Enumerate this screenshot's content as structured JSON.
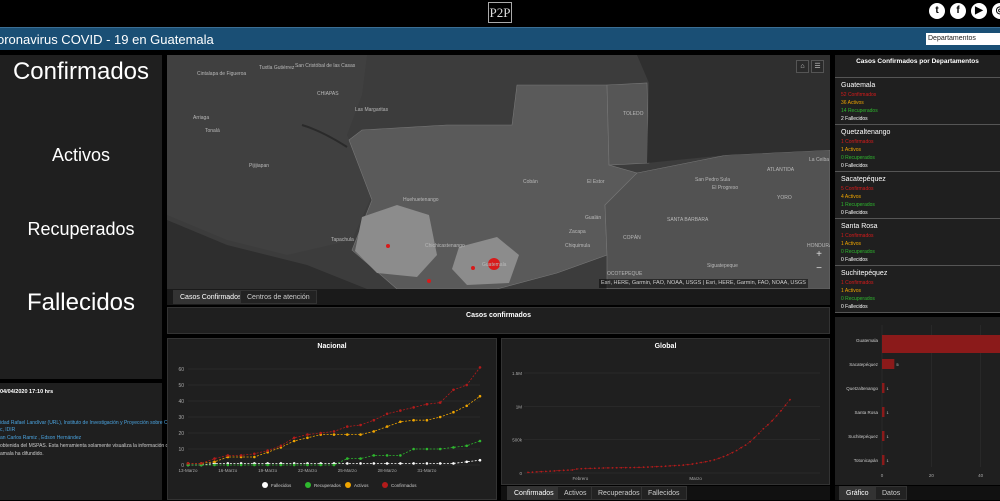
{
  "header": {
    "logo_text": "P2P",
    "title": "oronavirus COVID - 19 en Guatemala",
    "dept_select": "Departamentos"
  },
  "social": [
    {
      "icon": "twitter-icon",
      "glyph": "t"
    },
    {
      "icon": "facebook-icon",
      "glyph": "f"
    },
    {
      "icon": "youtube-icon",
      "glyph": "▶"
    },
    {
      "icon": "instagram-icon",
      "glyph": "◎"
    }
  ],
  "stats": {
    "confirmados": "Confirmados",
    "activos": "Activos",
    "recuperados": "Recuperados",
    "fallecidos": "Fallecidos"
  },
  "map": {
    "labels": [
      {
        "t": "Tuxtla Gutiérrez",
        "x": 92,
        "y": 10
      },
      {
        "t": "San Cristóbal de las Casas",
        "x": 128,
        "y": 8
      },
      {
        "t": "Cintalapa de Figueroa",
        "x": 30,
        "y": 16
      },
      {
        "t": "CHIAPAS",
        "x": 150,
        "y": 36
      },
      {
        "t": "Las Margaritas",
        "x": 188,
        "y": 52
      },
      {
        "t": "Arriaga",
        "x": 26,
        "y": 60
      },
      {
        "t": "Tonalá",
        "x": 38,
        "y": 73
      },
      {
        "t": "Pijijiapan",
        "x": 82,
        "y": 108
      },
      {
        "t": "Huehuetenango",
        "x": 236,
        "y": 142
      },
      {
        "t": "Cobán",
        "x": 356,
        "y": 124
      },
      {
        "t": "El Estor",
        "x": 420,
        "y": 124
      },
      {
        "t": "Chiquimula",
        "x": 398,
        "y": 188
      },
      {
        "t": "Gualán",
        "x": 418,
        "y": 160
      },
      {
        "t": "Zacapa",
        "x": 402,
        "y": 174
      },
      {
        "t": "Tapachula",
        "x": 164,
        "y": 182
      },
      {
        "t": "Chichicastenango",
        "x": 258,
        "y": 188
      },
      {
        "t": "Guatemala",
        "x": 315,
        "y": 207
      },
      {
        "t": "San Pedro Sula",
        "x": 528,
        "y": 122
      },
      {
        "t": "El Progreso",
        "x": 545,
        "y": 130
      },
      {
        "t": "La Ceiba",
        "x": 642,
        "y": 102
      },
      {
        "t": "ATLANTIDA",
        "x": 600,
        "y": 112
      },
      {
        "t": "YORO",
        "x": 610,
        "y": 140
      },
      {
        "t": "COPÁN",
        "x": 456,
        "y": 180
      },
      {
        "t": "SANTA BARBARA",
        "x": 500,
        "y": 162
      },
      {
        "t": "Siguatepeque",
        "x": 540,
        "y": 208
      },
      {
        "t": "OCOTEPEQUE",
        "x": 440,
        "y": 216
      },
      {
        "t": "TOLEDO",
        "x": 456,
        "y": 56
      },
      {
        "t": "HONDURAS",
        "x": 640,
        "y": 188
      }
    ],
    "attribution": "Esri, HERE, Garmin, FAO, NOAA, USGS | Esri, HERE, Garmin, FAO, NOAA, USGS",
    "zoom_in": "+",
    "zoom_out": "−",
    "tabs": [
      "Casos Confirmados",
      "Centros de atención"
    ]
  },
  "casos_header": "Casos confirmados",
  "departments_title": "Casos Confirmados por Departamentos",
  "departments": [
    {
      "name": "Guatemala",
      "confirmados": "52 Confirmados",
      "activos": "36 Activos",
      "recuperados": "14 Recuperados",
      "fallecidos": "2 Fallecidos"
    },
    {
      "name": "Quetzaltenango",
      "confirmados": "1 Confirmados",
      "activos": "1 Activos",
      "recuperados": "0 Recuperados",
      "fallecidos": "0 Fallecidos"
    },
    {
      "name": "Sacatepéquez",
      "confirmados": "5 Confirmados",
      "activos": "4 Activos",
      "recuperados": "1 Recuperados",
      "fallecidos": "0 Fallecidos"
    },
    {
      "name": "Santa Rosa",
      "confirmados": "1 Confirmados",
      "activos": "1 Activos",
      "recuperados": "0 Recuperados",
      "fallecidos": "0 Fallecidos"
    },
    {
      "name": "Suchitepéquez",
      "confirmados": "1 Confirmados",
      "activos": "1 Activos",
      "recuperados": "0 Recuperados",
      "fallecidos": "0 Fallecidos"
    },
    {
      "name": "Totonicapán",
      "confirmados": "",
      "activos": "",
      "recuperados": "",
      "fallecidos": ""
    }
  ],
  "info": {
    "updated": "04/04/2020 17:10 hrs",
    "line1": "idad Rafael Landívar (URL), Instituto de Investigación y Proyección sobre Ciencia",
    "line2": "c, IDIR",
    "line3": "an Carlos Ramiz , Edson Hernández",
    "line4": "obtenida del MSPAS. Esta herramienta solamente visualiza la información que el",
    "line5": "amala ha difundido."
  },
  "bottom_tabs": [
    "Confirmados",
    "Activos",
    "Recuperados",
    "Fallecidos"
  ],
  "right_tabs": [
    "Gráfico",
    "Datos"
  ],
  "colors": {
    "fallecidos": "#ffffff",
    "recuperados": "#2eb82e",
    "activos": "#f0a500",
    "confirmados": "#b31b1b"
  },
  "chart_data": [
    {
      "type": "line",
      "title": "Nacional",
      "categories": [
        "13-Marzo",
        "14-Marzo",
        "15-Marzo",
        "16-Marzo",
        "17-Marzo",
        "18-Marzo",
        "19-Marzo",
        "20-Marzo",
        "21-Marzo",
        "22-Marzo",
        "23-Marzo",
        "24-Marzo",
        "25-Marzo",
        "26-Marzo",
        "27-Marzo",
        "28-Marzo",
        "29-Marzo",
        "30-Marzo",
        "31-Marzo",
        "01-Abril",
        "02-Abril",
        "03-Abril",
        "04-Abril"
      ],
      "tick_labels": [
        "13-Marzo",
        "16-Marzo",
        "19-Marzo",
        "22-Marzo",
        "25-Marzo",
        "28-Marzo",
        "31-Marzo"
      ],
      "ylim": [
        0,
        60
      ],
      "yticks": [
        0,
        10,
        20,
        30,
        40,
        50,
        60
      ],
      "series": [
        {
          "name": "Fallecidos",
          "values": [
            0,
            0,
            1,
            1,
            1,
            1,
            1,
            1,
            1,
            1,
            1,
            1,
            1,
            1,
            1,
            1,
            1,
            1,
            1,
            1,
            1,
            2,
            3
          ]
        },
        {
          "name": "Recuperados",
          "values": [
            0,
            0,
            0,
            0,
            0,
            0,
            0,
            0,
            0,
            0,
            0,
            0,
            4,
            4,
            6,
            6,
            6,
            10,
            10,
            10,
            11,
            12,
            15
          ]
        },
        {
          "name": "Activos",
          "values": [
            1,
            1,
            2,
            5,
            5,
            5,
            8,
            11,
            15,
            17,
            19,
            19,
            19,
            19,
            21,
            24,
            27,
            28,
            28,
            30,
            33,
            37,
            43
          ]
        },
        {
          "name": "Confirmados",
          "values": [
            1,
            1,
            4,
            6,
            6,
            7,
            9,
            12,
            17,
            19,
            20,
            21,
            24,
            25,
            28,
            32,
            34,
            36,
            38,
            39,
            47,
            50,
            61
          ]
        }
      ]
    },
    {
      "type": "line",
      "title": "Global",
      "tick_labels": [
        "Febrero",
        "Marzo"
      ],
      "yticks": [
        "0",
        "500k",
        "1M",
        "1.5M"
      ],
      "ylim": [
        0,
        1500000
      ],
      "series": [
        {
          "name": "Confirmados",
          "values": [
            9000,
            12000,
            17000,
            20000,
            24000,
            28000,
            31000,
            35000,
            40000,
            43000,
            45000,
            60000,
            64000,
            67000,
            69000,
            71000,
            73000,
            75000,
            76000,
            77000,
            78000,
            79000,
            80000,
            81000,
            82000,
            84000,
            87000,
            89000,
            92000,
            95000,
            98000,
            102000,
            106000,
            110000,
            114000,
            119000,
            126000,
            134000,
            145000,
            157000,
            169000,
            182000,
            198000,
            219000,
            245000,
            273000,
            305000,
            338000,
            380000,
            418000,
            468000,
            530000,
            594000,
            663000,
            721000,
            785000,
            859000,
            936000,
            1017000,
            1100000
          ]
        }
      ]
    },
    {
      "type": "bar",
      "orientation": "horizontal",
      "categories": [
        "Guatemala",
        "Sacatepéquez",
        "Quetzaltenango",
        "Santa Rosa",
        "Suchitepéquez",
        "Totonicapán"
      ],
      "values": [
        52,
        5,
        1,
        1,
        1,
        1
      ],
      "xlim": [
        0,
        60
      ],
      "xticks": [
        0,
        20,
        40
      ]
    }
  ]
}
